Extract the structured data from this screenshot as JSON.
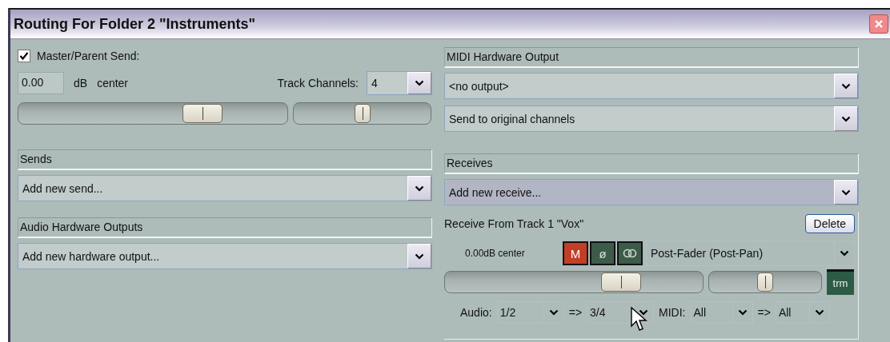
{
  "window": {
    "title": "Routing For Folder 2 \"Instruments\""
  },
  "master": {
    "label": "Master/Parent Send:",
    "checked": true,
    "volume_value": "0.00",
    "unit": "dB",
    "pan": "center",
    "channels_label": "Track Channels:",
    "channels_value": "4",
    "volume": {
      "level": 0.72
    },
    "pan_slider": {
      "level": 0.5
    }
  },
  "midi_hardware_output": {
    "header": "MIDI Hardware Output",
    "device": {
      "value": "<no output>",
      "focused": false
    },
    "channel_mode": {
      "value": "Send to original channels",
      "focused": false
    }
  },
  "sends": {
    "header": "Sends",
    "add": {
      "value": "Add new send...",
      "focused": false
    }
  },
  "audio_hardware_outputs": {
    "header": "Audio Hardware Outputs",
    "add": {
      "value": "Add new hardware output...",
      "focused": false
    }
  },
  "receives": {
    "header": "Receives",
    "add": {
      "value": "Add new receive...",
      "focused": true
    },
    "items": [
      {
        "title": "Receive From Track 1 \"Vox\"",
        "delete": "Delete",
        "readout": "0.00dB center",
        "toggles": [
          {
            "kind": "text",
            "label": "M",
            "on": true
          },
          {
            "kind": "text",
            "label": "ø",
            "on": false
          },
          {
            "kind": "stereo",
            "on": false
          }
        ],
        "mode": "Post-Fader (Post-Pan)",
        "volume": {
          "level": 0.72
        },
        "pan": {
          "level": 0.5
        },
        "trim": "trm",
        "audio_label": "Audio:",
        "audio_src": "1/2",
        "audio_arrow": "=>",
        "audio_dst": "3/4",
        "midi_label": "MIDI:",
        "midi_src": "All",
        "midi_arrow": "=>",
        "midi_dst": "All"
      }
    ]
  }
}
